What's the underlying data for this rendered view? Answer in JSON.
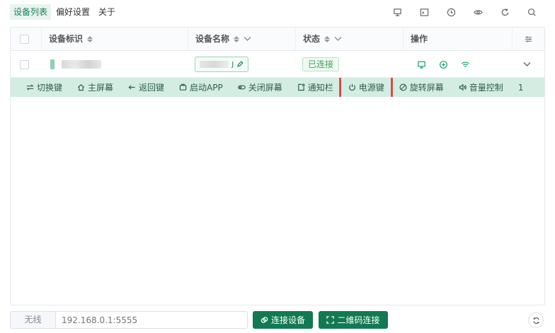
{
  "nav": {
    "tabs": [
      "设备列表",
      "偏好设置",
      "关于"
    ],
    "active": 0
  },
  "toolbar": {
    "icons": [
      "pin-icon",
      "terminal-icon",
      "clock-icon",
      "eye-icon",
      "refresh-icon",
      "search-icon"
    ]
  },
  "table": {
    "columns": {
      "id": "设备标识",
      "name": "设备名称",
      "status": "状态",
      "ops": "操作"
    },
    "rows": [
      {
        "name_suffix": "J",
        "status": "已连接"
      }
    ],
    "actions": [
      {
        "label": "切换键",
        "icon": "switch-icon"
      },
      {
        "label": "主屏幕",
        "icon": "home-icon"
      },
      {
        "label": "返回键",
        "icon": "back-arrow-icon"
      },
      {
        "label": "启动APP",
        "icon": "app-icon"
      },
      {
        "label": "关闭屏幕",
        "icon": "toggle-icon"
      },
      {
        "label": "通知栏",
        "icon": "notification-icon"
      },
      {
        "label": "电源键",
        "icon": "power-icon"
      },
      {
        "label": "旋转屏幕",
        "icon": "rotate-icon"
      },
      {
        "label": "音量控制",
        "icon": "volume-icon"
      }
    ],
    "actions_more": "1"
  },
  "bottom": {
    "mode": "无线",
    "ip_placeholder": "192.168.0.1:5555",
    "connect_label": "连接设备",
    "qr_label": "二维码连接"
  },
  "colors": {
    "accent": "#117a52",
    "highlight_border": "#e04848",
    "action_bar": "#d4ede3"
  }
}
